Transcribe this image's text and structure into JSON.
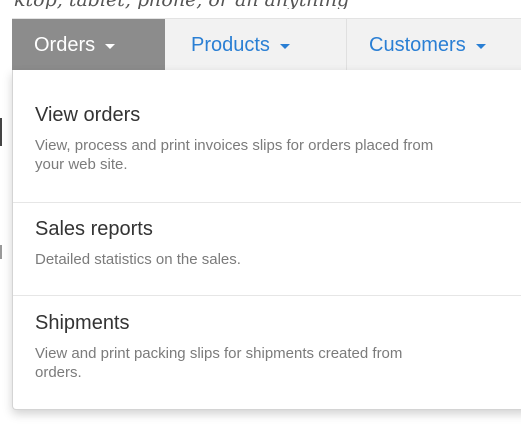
{
  "background_strip_text": "ktop, tablet, phone, or an anything",
  "nav": {
    "items": [
      {
        "label": "Orders",
        "active": true
      },
      {
        "label": "Products",
        "active": false
      },
      {
        "label": "Customers",
        "active": false
      }
    ]
  },
  "dropdown": {
    "items": [
      {
        "title": "View orders",
        "description": "View, process and print invoices slips for orders placed from your web site."
      },
      {
        "title": "Sales reports",
        "description": "Detailed statistics on the sales."
      },
      {
        "title": "Shipments",
        "description": "View and print packing slips for shipments created from orders."
      }
    ]
  },
  "colors": {
    "nav_background": "#f2f2f2",
    "active_background": "#8c8c8c",
    "link_blue": "#2a7fd4",
    "title_text": "#333333",
    "description_text": "#7b7b7b"
  },
  "icons": {
    "caret": "caret-down-icon"
  }
}
